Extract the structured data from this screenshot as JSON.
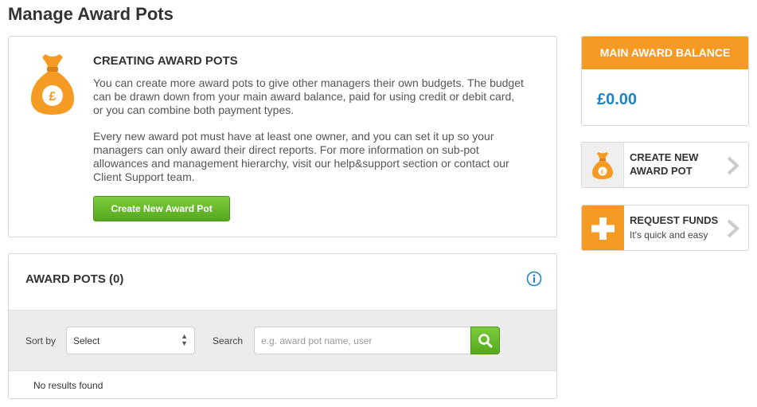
{
  "page": {
    "title": "Manage Award Pots"
  },
  "intro": {
    "title": "CREATING AWARD POTS",
    "para1_lines": [
      "You can create more award pots to give other managers their own budgets. The budget",
      "can be drawn down from your main award balance, paid for using credit or debit card,",
      "or you can combine both payment types."
    ],
    "para2_lines": [
      "Every new award pot must have at least one owner, and you can set it up so your",
      "managers can only award their direct reports. For more information on sub-pot",
      "allowances and management hierarchy, visit our help&support section or contact our",
      "Client Support team."
    ],
    "button_label": "Create New Award Pot",
    "icon": "money-bag-icon"
  },
  "award_pots": {
    "title": "AWARD POTS (0)",
    "info_icon": "info-icon",
    "sort_label": "Sort by",
    "sort_value": "Select",
    "search_label": "Search",
    "search_placeholder": "e.g. award pot name, user",
    "search_value": "",
    "empty_text": "No results found"
  },
  "balance": {
    "header": "MAIN AWARD BALANCE",
    "amount": "£0.00"
  },
  "actions": {
    "create": {
      "line1": "CREATE NEW",
      "line2": "AWARD POT",
      "icon": "money-bag-icon"
    },
    "request": {
      "title": "REQUEST FUNDS",
      "subtitle": "It's quick and easy",
      "icon": "plus-icon"
    }
  },
  "colors": {
    "accent_orange": "#f59a23",
    "accent_green": "#5cb82a",
    "balance_blue": "#1b84c6"
  }
}
